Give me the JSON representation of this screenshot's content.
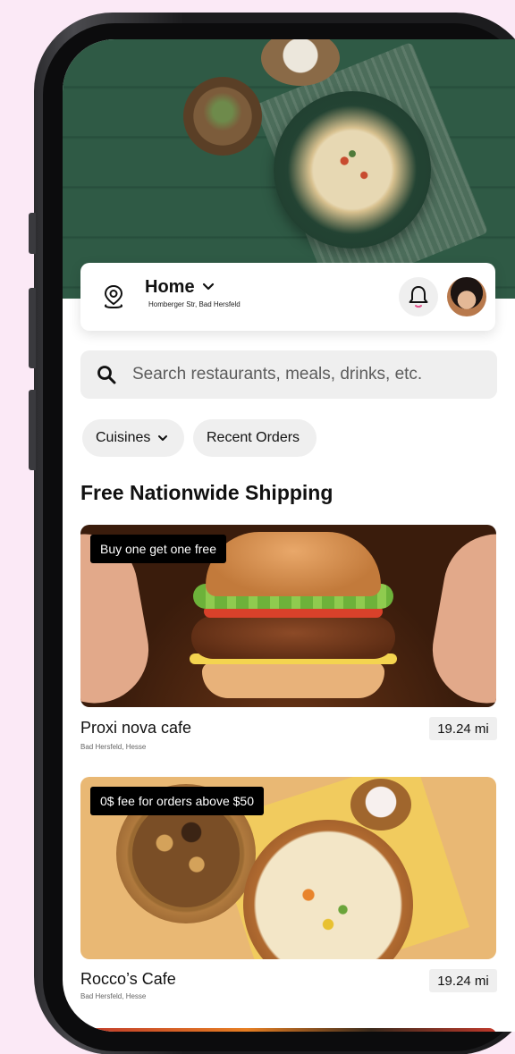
{
  "header": {
    "location_title": "Home",
    "location_subtitle": "Homberger Str, Bad Hersfeld"
  },
  "search": {
    "placeholder": "Search restaurants, meals, drinks, etc."
  },
  "filters": [
    {
      "label": "Cuisines",
      "has_dropdown": true
    },
    {
      "label": "Recent Orders",
      "has_dropdown": false
    }
  ],
  "section": {
    "title": "Free Nationwide Shipping"
  },
  "restaurants": [
    {
      "promo": "Buy one get one free",
      "name": "Proxi nova cafe",
      "location": "Bad Hersfeld, Hesse",
      "distance": "19.24 mi"
    },
    {
      "promo": "0$ fee for orders above $50",
      "name": "Rocco’s Cafe",
      "location": "Bad Hersfeld, Hesse",
      "distance": "19.24 mi"
    }
  ],
  "icons": [
    "location-pin-icon",
    "chevron-down-icon",
    "bell-icon",
    "search-icon"
  ],
  "colors": {
    "background": "#fbe9f6",
    "hero_green": "#2f5a45",
    "chip_bg": "#efefef",
    "promo_bg": "#000000",
    "notification_accent": "#e0528a"
  }
}
